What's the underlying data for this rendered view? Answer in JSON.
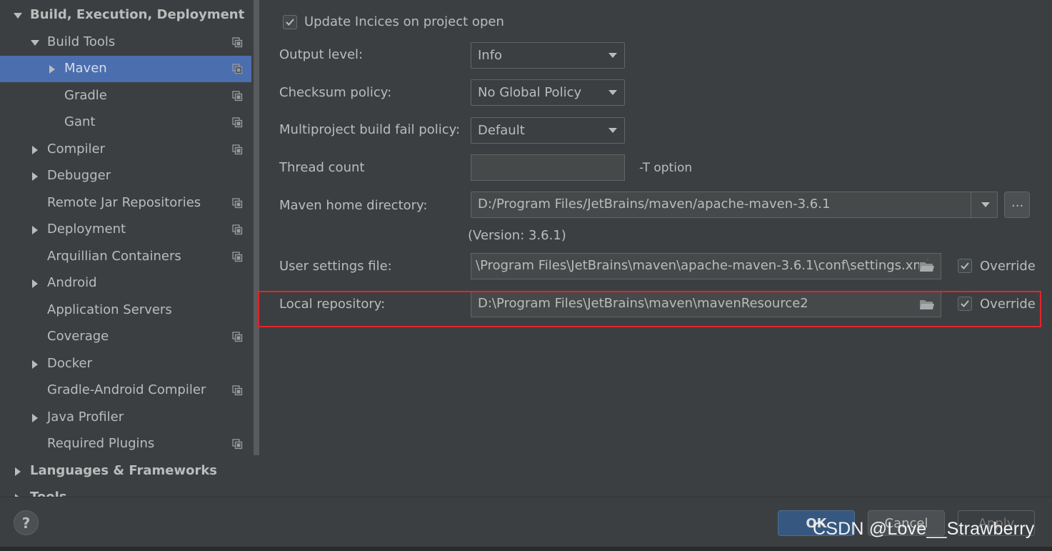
{
  "sidebar": {
    "items": [
      {
        "label": "Build, Execution, Deployment",
        "bold": true,
        "arrow": "down",
        "copy": false
      },
      {
        "label": "Build Tools",
        "bold": false,
        "arrow": "down",
        "copy": true
      },
      {
        "label": "Maven",
        "bold": false,
        "arrow": "right",
        "copy": true,
        "selected": true
      },
      {
        "label": "Gradle",
        "bold": false,
        "arrow": "",
        "copy": true
      },
      {
        "label": "Gant",
        "bold": false,
        "arrow": "",
        "copy": true
      },
      {
        "label": "Compiler",
        "bold": false,
        "arrow": "right",
        "copy": true
      },
      {
        "label": "Debugger",
        "bold": false,
        "arrow": "right",
        "copy": false
      },
      {
        "label": "Remote Jar Repositories",
        "bold": false,
        "arrow": "",
        "copy": true
      },
      {
        "label": "Deployment",
        "bold": false,
        "arrow": "right",
        "copy": true
      },
      {
        "label": "Arquillian Containers",
        "bold": false,
        "arrow": "",
        "copy": true
      },
      {
        "label": "Android",
        "bold": false,
        "arrow": "right",
        "copy": false
      },
      {
        "label": "Application Servers",
        "bold": false,
        "arrow": "",
        "copy": false
      },
      {
        "label": "Coverage",
        "bold": false,
        "arrow": "",
        "copy": true
      },
      {
        "label": "Docker",
        "bold": false,
        "arrow": "right",
        "copy": false
      },
      {
        "label": "Gradle-Android Compiler",
        "bold": false,
        "arrow": "",
        "copy": true
      },
      {
        "label": "Java Profiler",
        "bold": false,
        "arrow": "right",
        "copy": false
      },
      {
        "label": "Required Plugins",
        "bold": false,
        "arrow": "",
        "copy": true
      },
      {
        "label": "Languages & Frameworks",
        "bold": true,
        "arrow": "right",
        "copy": false
      },
      {
        "label": "Tools",
        "bold": true,
        "arrow": "right",
        "copy": false
      }
    ]
  },
  "settings": {
    "update_indices_label": "Update Incices on project open",
    "update_indices_checked": true,
    "output_level_label": "Output level:",
    "output_level_value": "Info",
    "checksum_policy_label": "Checksum policy:",
    "checksum_policy_value": "No Global Policy",
    "multiproject_label": "Multiproject build fail policy:",
    "multiproject_value": "Default",
    "thread_count_label": "Thread count",
    "thread_count_value": "",
    "thread_count_hint": "-T option",
    "maven_home_label": "Maven home directory:",
    "maven_home_value": "D:/Program Files/JetBrains/maven/apache-maven-3.6.1",
    "browse_label": "...",
    "version_text": "(Version: 3.6.1)",
    "user_settings_label": "User settings file:",
    "user_settings_value": "\\Program Files\\JetBrains\\maven\\apache-maven-3.6.1\\conf\\settings.xml",
    "user_settings_override_label": "Override",
    "user_settings_override_checked": true,
    "local_repo_label": "Local repository:",
    "local_repo_value": "D:\\Program Files\\JetBrains\\maven\\mavenResource2",
    "local_repo_override_label": "Override",
    "local_repo_override_checked": true
  },
  "footer": {
    "help_label": "?",
    "ok_label": "OK",
    "cancel_label": "Cancel",
    "apply_label": "Apply"
  },
  "watermark": "CSDN @Love__Strawberry",
  "colors": {
    "background": "#3c3f41",
    "selection": "#4b6eaf",
    "highlight_box": "#e3242b",
    "ok_button": "#365880"
  }
}
